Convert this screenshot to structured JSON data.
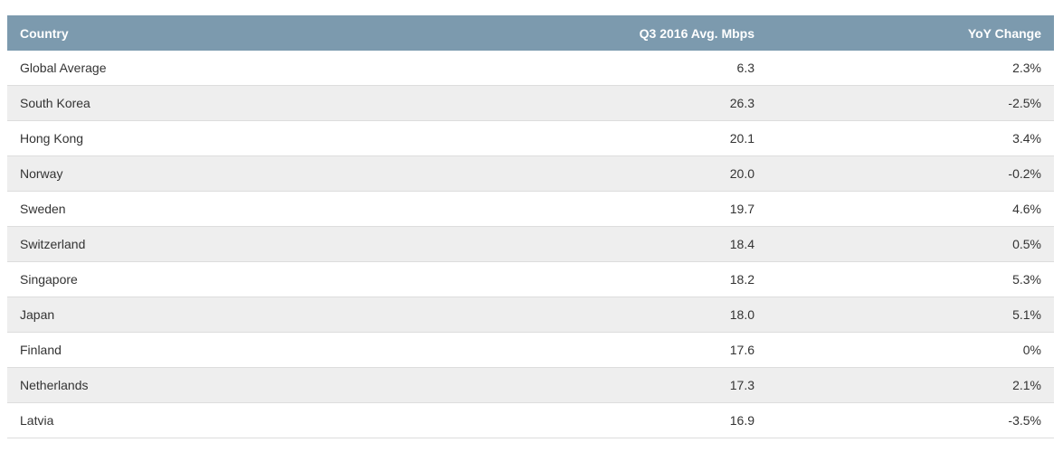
{
  "table": {
    "headers": {
      "country": "Country",
      "speed": "Q3 2016 Avg. Mbps",
      "change": "YoY Change"
    },
    "rows": [
      {
        "country": "Global Average",
        "speed": "6.3",
        "change": "2.3%"
      },
      {
        "country": "South Korea",
        "speed": "26.3",
        "change": "-2.5%"
      },
      {
        "country": "Hong Kong",
        "speed": "20.1",
        "change": "3.4%"
      },
      {
        "country": "Norway",
        "speed": "20.0",
        "change": "-0.2%"
      },
      {
        "country": "Sweden",
        "speed": "19.7",
        "change": "4.6%"
      },
      {
        "country": "Switzerland",
        "speed": "18.4",
        "change": "0.5%"
      },
      {
        "country": "Singapore",
        "speed": "18.2",
        "change": "5.3%"
      },
      {
        "country": "Japan",
        "speed": "18.0",
        "change": "5.1%"
      },
      {
        "country": "Finland",
        "speed": "17.6",
        "change": "0%"
      },
      {
        "country": "Netherlands",
        "speed": "17.3",
        "change": "2.1%"
      },
      {
        "country": "Latvia",
        "speed": "16.9",
        "change": "-3.5%"
      }
    ]
  },
  "colors": {
    "header_background": "#7c9aae",
    "header_text": "#ffffff",
    "stripe_background": "#eeeeee",
    "row_background": "#ffffff"
  }
}
